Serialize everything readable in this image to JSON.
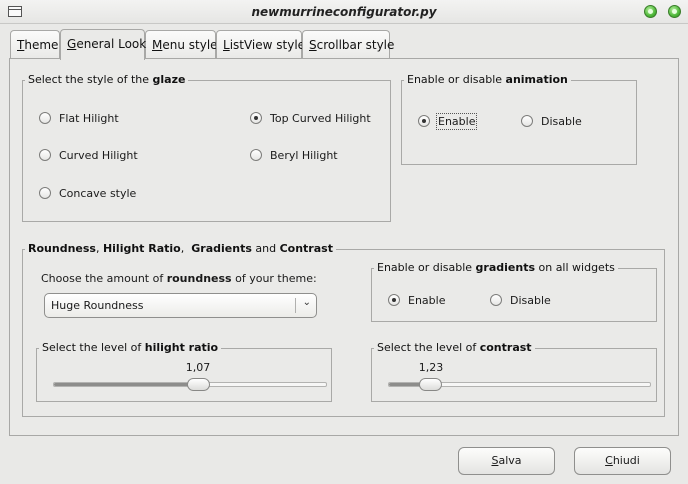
{
  "window": {
    "title": "newmurrineconfigurator.py"
  },
  "tabs": [
    {
      "label": "Theme",
      "mnemonic": "T",
      "rest": "heme"
    },
    {
      "label": "General Look",
      "mnemonic": "G",
      "rest": "eneral Look"
    },
    {
      "label": "Menu style",
      "mnemonic": "M",
      "rest": "enu style"
    },
    {
      "label": "ListView style",
      "mnemonic": "L",
      "rest": "istView style"
    },
    {
      "label": "Scrollbar style",
      "mnemonic": "S",
      "rest": "crollbar style"
    }
  ],
  "active_tab": "General Look",
  "glaze": {
    "legend_pre": "Select the style of the ",
    "legend_bold": "glaze",
    "options": [
      {
        "label": "Flat Hilight",
        "selected": false
      },
      {
        "label": "Top Curved Hilight",
        "selected": true
      },
      {
        "label": "Curved Hilight",
        "selected": false
      },
      {
        "label": "Beryl Hilight",
        "selected": false
      },
      {
        "label": "Concave style",
        "selected": false
      }
    ]
  },
  "animation": {
    "legend_pre": "Enable or disable ",
    "legend_bold": "animation",
    "options": [
      {
        "label": "Enable",
        "selected": true
      },
      {
        "label": "Disable",
        "selected": false
      }
    ]
  },
  "roundness_group": {
    "legend_b1": "Roundness",
    "legend_t1": ", ",
    "legend_b2": "Hilight Ratio",
    "legend_t2": ",  ",
    "legend_b3": "Gradients",
    "legend_t3": " and ",
    "legend_b4": "Contrast",
    "roundness_label_pre": "Choose the amount of ",
    "roundness_label_bold": "roundness",
    "roundness_label_post": " of your theme:",
    "roundness_value": "Huge Roundness",
    "gradients": {
      "legend_pre": "Enable or disable ",
      "legend_bold": "gradients",
      "legend_post": " on all widgets",
      "options": [
        {
          "label": "Enable",
          "selected": true
        },
        {
          "label": "Disable",
          "selected": false
        }
      ]
    },
    "hilight_ratio": {
      "legend_pre": "Select the level of ",
      "legend_bold": "hilight ratio",
      "value": "1,07",
      "fraction": 0.53
    },
    "contrast": {
      "legend_pre": "Select the level of ",
      "legend_bold": "contrast",
      "value": "1,23",
      "fraction": 0.16
    }
  },
  "buttons": {
    "save": {
      "label": "Salva",
      "mnemonic": "S",
      "rest": "alva"
    },
    "close": {
      "label": "Chiudi",
      "mnemonic": "C",
      "rest": "hiudi"
    }
  },
  "colors": {
    "background": "#e9e9e7",
    "window_button": "#4fb83a"
  },
  "icons": [
    "window-menu-icon",
    "minimize-icon",
    "close-icon",
    "radio-icon",
    "chevron-down-icon",
    "slider-handle"
  ]
}
